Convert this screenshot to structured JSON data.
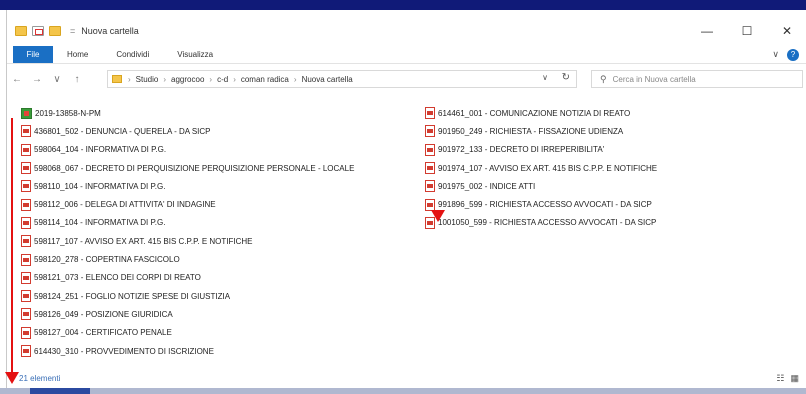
{
  "window": {
    "title": "Nuova cartella",
    "qa_separator": "=",
    "controls": {
      "minimize": "—",
      "maximize": "☐",
      "close": "✕"
    }
  },
  "ribbon": {
    "tabs": [
      "File",
      "Home",
      "Condividi",
      "Visualizza"
    ],
    "expand": "∨"
  },
  "nav": {
    "back": "←",
    "forward": "→",
    "recent": "∨",
    "up": "↑",
    "breadcrumb": [
      "Studio",
      "aggrocoo",
      "c-d",
      "coman radica",
      "Nuova cartella"
    ],
    "dropdown": "∨",
    "refresh": "↻"
  },
  "search": {
    "placeholder": "Cerca in Nuova cartella"
  },
  "files_col1": [
    {
      "name": "2019-13858-N-PM",
      "type": "exe"
    },
    {
      "name": "436801_502 - DENUNCIA - QUERELA - DA SICP",
      "type": "pdf"
    },
    {
      "name": "598064_104 - INFORMATIVA DI P.G.",
      "type": "pdf"
    },
    {
      "name": "598068_067 - DECRETO DI PERQUISIZIONE PERQUISIZIONE PERSONALE - LOCALE",
      "type": "pdf"
    },
    {
      "name": "598110_104 - INFORMATIVA DI P.G.",
      "type": "pdf"
    },
    {
      "name": "598112_006 - DELEGA DI ATTIVITA' DI INDAGINE",
      "type": "pdf"
    },
    {
      "name": "598114_104 - INFORMATIVA DI P.G.",
      "type": "pdf"
    },
    {
      "name": "598117_107 - AVVISO EX ART. 415 BIS C.P.P. E NOTIFICHE",
      "type": "pdf"
    },
    {
      "name": "598120_278 - COPERTINA FASCICOLO",
      "type": "pdf"
    },
    {
      "name": "598121_073 - ELENCO DEI CORPI DI REATO",
      "type": "pdf"
    },
    {
      "name": "598124_251 - FOGLIO NOTIZIE SPESE DI GIUSTIZIA",
      "type": "pdf"
    },
    {
      "name": "598126_049 - POSIZIONE GIURIDICA",
      "type": "pdf"
    },
    {
      "name": "598127_004 - CERTIFICATO PENALE",
      "type": "pdf"
    },
    {
      "name": "614430_310 - PROVVEDIMENTO DI ISCRIZIONE",
      "type": "pdf"
    }
  ],
  "files_col2": [
    {
      "name": "614461_001 - COMUNICAZIONE NOTIZIA DI REATO",
      "type": "pdf"
    },
    {
      "name": "901950_249 - RICHIESTA - FISSAZIONE UDIENZA",
      "type": "pdf"
    },
    {
      "name": "901972_133 - DECRETO DI IRREPERIBILITA'",
      "type": "pdf"
    },
    {
      "name": "901974_107 - AVVISO EX ART. 415 BIS C.P.P. E NOTIFICHE",
      "type": "pdf"
    },
    {
      "name": "901975_002 - INDICE ATTI",
      "type": "pdf"
    },
    {
      "name": "991896_599 - RICHIESTA ACCESSO AVVOCATI - DA SICP",
      "type": "pdf"
    },
    {
      "name": "1001050_599 - RICHIESTA ACCESSO AVVOCATI - DA SICP",
      "type": "pdf"
    }
  ],
  "status": {
    "count": "21 elementi",
    "view_details": "☷",
    "view_icons": "▦"
  },
  "colors": {
    "accent": "#1a6fc4",
    "annotation": "#e41111",
    "pdf": "#d23b2f"
  }
}
